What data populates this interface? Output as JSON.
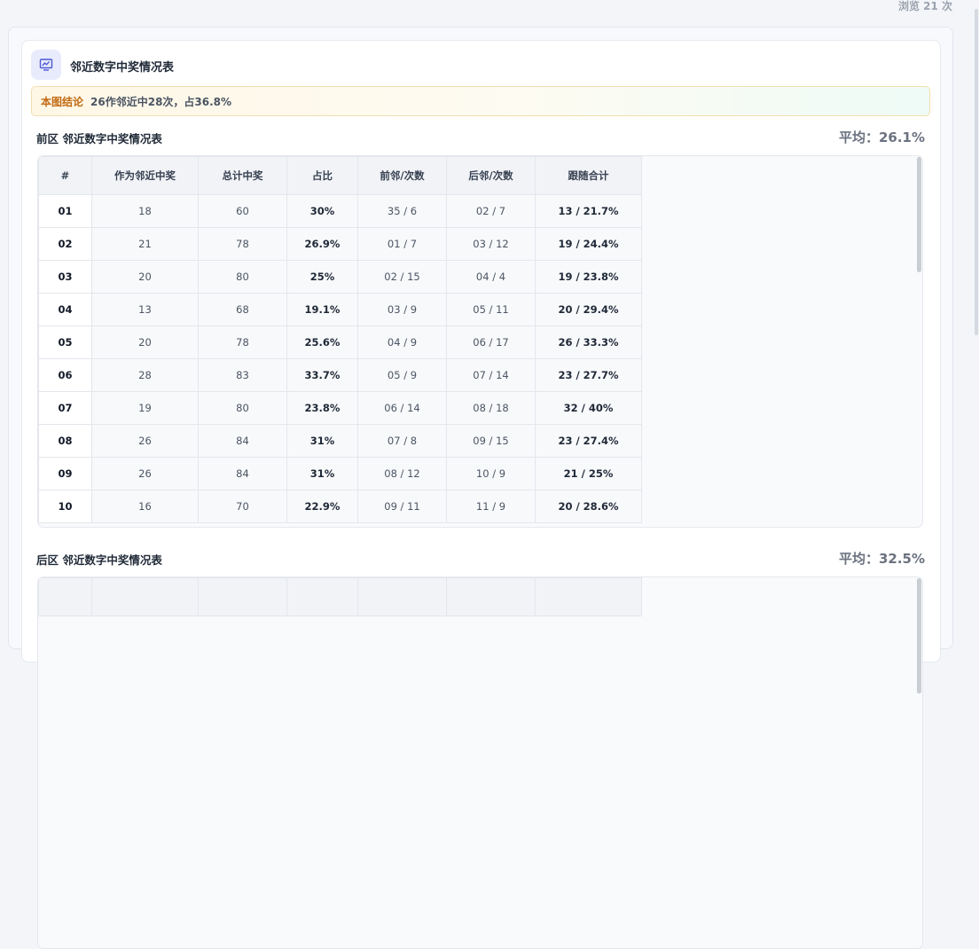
{
  "header": {
    "views": "浏览 21 次"
  },
  "card": {
    "title": "邻近数字中奖情况表",
    "conclusion_tag": "本图结论",
    "conclusion_text": "26作邻近中28次，占36.8%"
  },
  "front": {
    "title": "前区 邻近数字中奖情况表",
    "average": "平均：26.1%",
    "columns": [
      "#",
      "作为邻近中奖",
      "总计中奖",
      "占比",
      "前邻/次数",
      "后邻/次数",
      "跟随合计"
    ],
    "rows": [
      [
        "01",
        "18",
        "60",
        "30%",
        "35 / 6",
        "02 / 7",
        "13 / 21.7%"
      ],
      [
        "02",
        "21",
        "78",
        "26.9%",
        "01 / 7",
        "03 / 12",
        "19 / 24.4%"
      ],
      [
        "03",
        "20",
        "80",
        "25%",
        "02 / 15",
        "04 / 4",
        "19 / 23.8%"
      ],
      [
        "04",
        "13",
        "68",
        "19.1%",
        "03 / 9",
        "05 / 11",
        "20 / 29.4%"
      ],
      [
        "05",
        "20",
        "78",
        "25.6%",
        "04 / 9",
        "06 / 17",
        "26 / 33.3%"
      ],
      [
        "06",
        "28",
        "83",
        "33.7%",
        "05 / 9",
        "07 / 14",
        "23 / 27.7%"
      ],
      [
        "07",
        "19",
        "80",
        "23.8%",
        "06 / 14",
        "08 / 18",
        "32 / 40%"
      ],
      [
        "08",
        "26",
        "84",
        "31%",
        "07 / 8",
        "09 / 15",
        "23 / 27.4%"
      ],
      [
        "09",
        "26",
        "84",
        "31%",
        "08 / 12",
        "10 / 9",
        "21 / 25%"
      ],
      [
        "10",
        "16",
        "70",
        "22.9%",
        "09 / 11",
        "11 / 9",
        "20 / 28.6%"
      ]
    ]
  },
  "back": {
    "title": "后区 邻近数字中奖情况表",
    "average": "平均：32.5%"
  },
  "icons": {
    "header_icon": "chart-presentation-icon"
  }
}
